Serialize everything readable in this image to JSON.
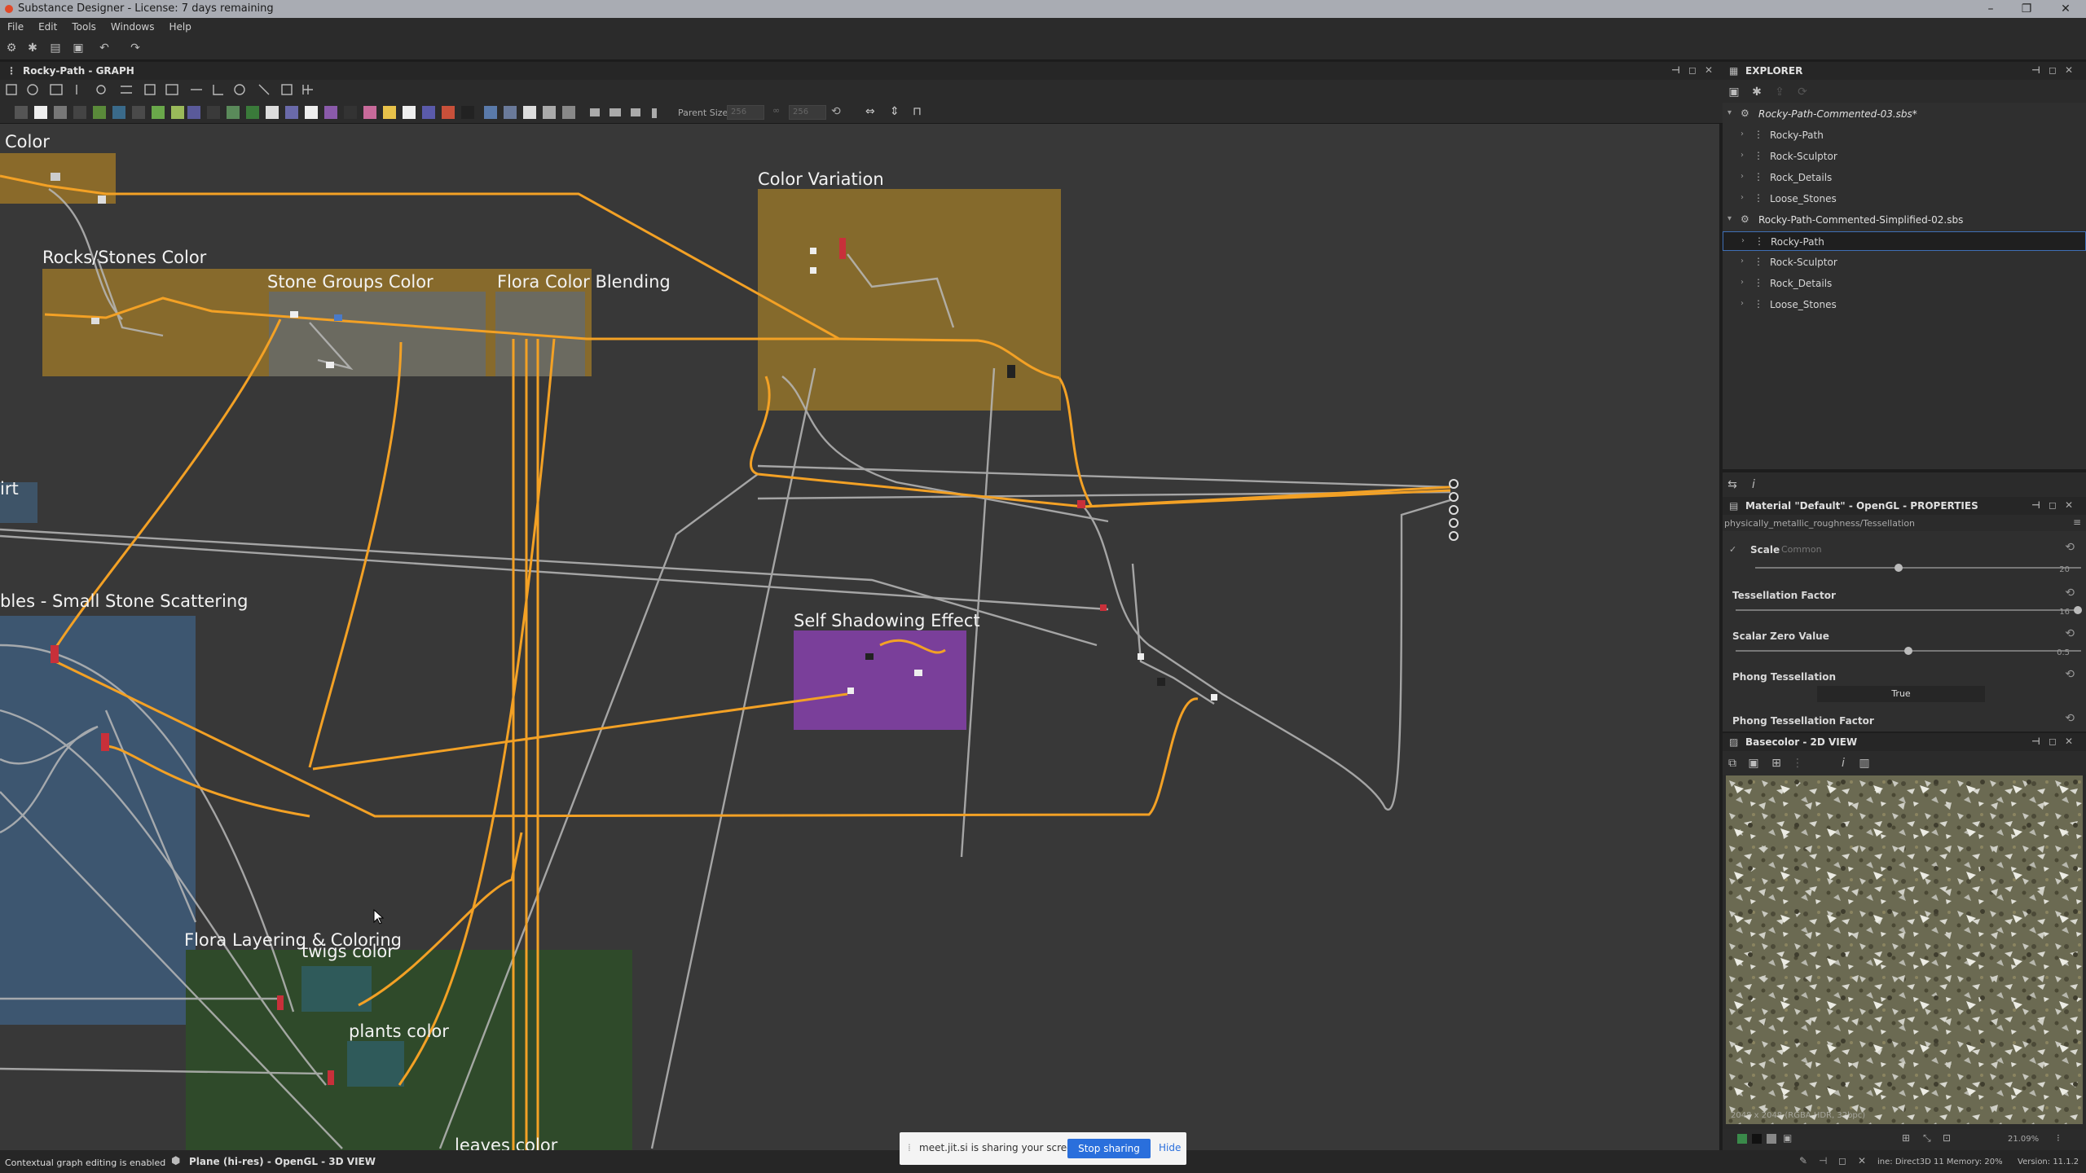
{
  "window": {
    "title": "Substance Designer - License: 7 days remaining",
    "controls": [
      "–",
      "❐",
      "✕"
    ]
  },
  "menu": [
    "File",
    "Edit",
    "Tools",
    "Windows",
    "Help"
  ],
  "graph": {
    "title": "Rocky-Path - GRAPH",
    "parent_size_label": "Parent Size:",
    "parent_size_value": "256",
    "frames": {
      "color": "Color",
      "rocks_stones_color": "Rocks/Stones Color",
      "stone_groups_color": "Stone Groups Color",
      "flora_color_blending": "Flora Color Blending",
      "color_variation": "Color Variation",
      "dirt": "irt",
      "pebbles": "bles - Small Stone Scattering",
      "self_shadowing": "Self Shadowing Effect",
      "flora_layering": "Flora Layering & Coloring",
      "twigs_color": "twigs color",
      "plants_color": "plants color",
      "leaves_color": "leaves color"
    },
    "colors": {
      "canvas": "#383838",
      "orange_frame": "#8a6a2a",
      "wire_orange": "#f3a125",
      "wire_gray": "#b8b8b8",
      "purple": "#7a3f9a",
      "blue": "#3d5a78",
      "green": "#2f4a2a"
    }
  },
  "explorer": {
    "title": "EXPLORER",
    "packages": [
      {
        "name": "Rocky-Path-Commented-03.sbs*",
        "graphs": [
          "Rocky-Path",
          "Rock-Sculptor",
          "Rock_Details",
          "Loose_Stones"
        ]
      },
      {
        "name": "Rocky-Path-Commented-Simplified-02.sbs",
        "graphs": [
          "Rocky-Path",
          "Rock-Sculptor",
          "Rock_Details",
          "Loose_Stones"
        ]
      }
    ]
  },
  "properties": {
    "title": "Material \"Default\" - OpenGL - PROPERTIES",
    "shader": "physically_metallic_roughness/Tessellation",
    "scale": {
      "label": "Scale",
      "group": "Common",
      "value": "20",
      "fraction": 0.44
    },
    "tessellation_factor": {
      "label": "Tessellation Factor",
      "value": "16",
      "fraction": 0.99
    },
    "scalar_zero": {
      "label": "Scalar Zero Value",
      "value": "0.5",
      "fraction": 0.5
    },
    "phong": {
      "label": "Phong Tessellation",
      "value": "True"
    },
    "phong_factor": {
      "label": "Phong Tessellation Factor"
    }
  },
  "view2d": {
    "title": "Basecolor - 2D VIEW",
    "info": "2048 x 2048 (RGBA HDR, 32bpc)",
    "zoom": "21.09%"
  },
  "status": {
    "left": "Contextual graph editing is enabled",
    "view3d": "Plane (hi-res) - OpenGL - 3D VIEW",
    "engine": "ine: Direct3D 11 Memory: 20%",
    "version": "Version: 11.1.2"
  },
  "share": {
    "text": "meet.jit.si is sharing your screen.",
    "stop": "Stop sharing",
    "hide": "Hide"
  }
}
